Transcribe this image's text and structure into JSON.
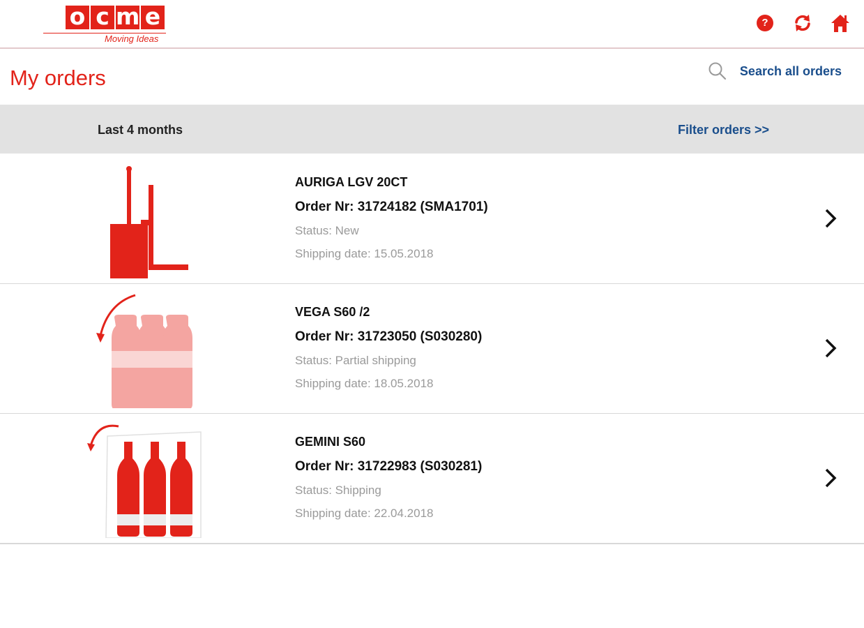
{
  "header": {
    "logo_letters": [
      "o",
      "c",
      "m",
      "e"
    ],
    "logo_tagline": "Moving Ideas",
    "icons": [
      "help-icon",
      "refresh-icon",
      "home-icon"
    ],
    "help_glyph": "?"
  },
  "page": {
    "title": "My orders",
    "search_label": "Search all orders"
  },
  "filter": {
    "period": "Last 4 months",
    "filter_label": "Filter orders >>"
  },
  "orders": [
    {
      "name": "AURIGA LGV 20CT",
      "order_nr": "Order Nr: 31724182 (SMA1701)",
      "status": "Status: New",
      "shipping_date": "Shipping date: 15.05.2018",
      "icon": "forklift-icon"
    },
    {
      "name": "VEGA S60 /2",
      "order_nr": "Order Nr: 31723050 (S030280)",
      "status": "Status: Partial shipping",
      "shipping_date": "Shipping date: 18.05.2018",
      "icon": "bottle-pack-icon"
    },
    {
      "name": "GEMINI S60",
      "order_nr": "Order Nr: 31722983 (S030281)",
      "status": "Status: Shipping",
      "shipping_date": "Shipping date: 22.04.2018",
      "icon": "bottle-tray-icon"
    }
  ],
  "colors": {
    "brand_red": "#e2231a",
    "link_blue": "#1a4e8c",
    "filter_bar_bg": "#e2e2e2",
    "muted_text": "#9a9a9a"
  }
}
